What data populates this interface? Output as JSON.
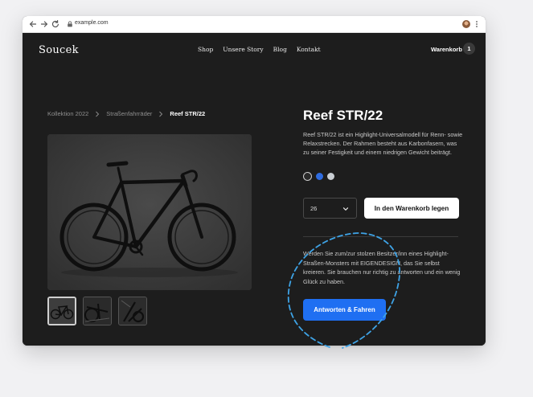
{
  "browser": {
    "url": "example.com",
    "icons": [
      "back-arrow-icon",
      "forward-arrow-icon",
      "reload-icon",
      "lock-icon",
      "avatar",
      "kebab-menu-icon"
    ]
  },
  "site": {
    "logo": "Soucek",
    "nav": [
      "Shop",
      "Unsere Story",
      "Blog",
      "Kontakt"
    ],
    "cart": {
      "label": "Warenkorb",
      "count": "1"
    }
  },
  "breadcrumb": [
    "Kollektion 2022",
    "Straßenfahrräder",
    "Reef STR/22"
  ],
  "product": {
    "title": "Reef STR/22",
    "description": "Reef STR/22 ist ein Highlight-Universalmodell für Renn- sowie Relaxstrecken. Der Rahmen besteht aus Karbonfasern, was zu seiner Festigkeit und einem niedrigen Gewicht beiträgt.",
    "colors": [
      "#2a2a2a",
      "#2f6ce0",
      "#c9ced3"
    ],
    "selected_color_index": 0,
    "size_value": "26",
    "add_to_cart_label": "In den Warenkorb legen",
    "promo_text": "Werden Sie zum/zur stolzen Besitzer/inn eines Highlight-Straßen-Monsters mit EIGENDESIGN, das Sie selbst kreieren. Sie brauchen nur richtig zu antworten und ein wenig Glück zu haben.",
    "cta_label": "Antworten & Fahren"
  },
  "colors": {
    "background": "#1d1d1d",
    "accent": "#1f6ff2",
    "annotation": "#3ea3e6"
  }
}
